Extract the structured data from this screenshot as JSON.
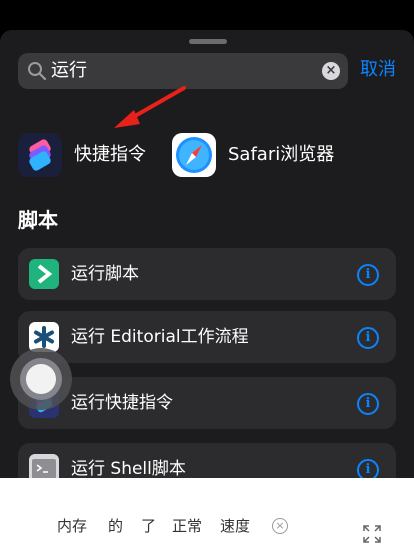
{
  "search": {
    "query": "运行",
    "cancel_label": "取消"
  },
  "apps": [
    {
      "label": "快捷指令",
      "icon": "shortcuts-app-icon"
    },
    {
      "label": "Safari浏览器",
      "icon": "safari-app-icon"
    }
  ],
  "section": {
    "title": "脚本"
  },
  "actions": [
    {
      "label": "运行脚本",
      "icon": "scriptable-icon"
    },
    {
      "label": "运行 Editorial工作流程",
      "icon": "editorial-icon"
    },
    {
      "label": "运行快捷指令",
      "icon": "shortcuts-icon"
    },
    {
      "label": "运行 Shell脚本",
      "icon": "terminal-icon"
    }
  ],
  "bottom": {
    "items": [
      "内存",
      "的",
      "了",
      "正常",
      "速度"
    ]
  },
  "colors": {
    "accent": "#0a84ff",
    "sheet": "#1c1c1e",
    "row": "#2c2c2e",
    "arrow": "#e8221b"
  }
}
